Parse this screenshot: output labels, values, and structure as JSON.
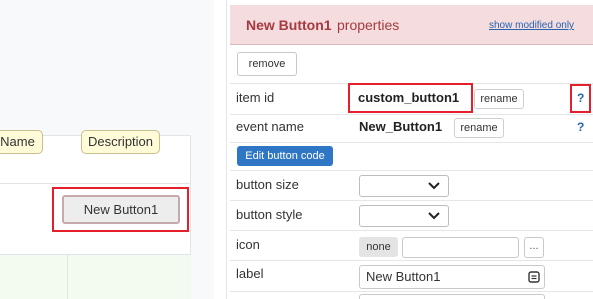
{
  "canvas": {
    "preview_button_label": "New Button1",
    "grid_headers": [
      "Name",
      "Description"
    ]
  },
  "panel": {
    "title": "New Button1",
    "title_suffix": "properties",
    "show_modified_label": "show modified only",
    "remove_label": "remove",
    "edit_code_label": "Edit button code",
    "help_glyph": "?",
    "rows": {
      "item_id": {
        "label": "item id",
        "value": "custom_button1",
        "rename_label": "rename"
      },
      "event_name": {
        "label": "event name",
        "value": "New_Button1",
        "rename_label": "rename"
      },
      "button_size": {
        "label": "button size",
        "value": ""
      },
      "button_style": {
        "label": "button style",
        "value": ""
      },
      "icon": {
        "label": "icon",
        "none_label": "none",
        "value": "",
        "browse_label": "..."
      },
      "label": {
        "label": "label",
        "value": "New Button1"
      }
    }
  },
  "colors": {
    "header_bg": "#f4dcdf",
    "title_color": "#a63a3e",
    "highlight_red": "#e5202a",
    "link_blue": "#2563b0",
    "primary_button": "#2f77c4",
    "chip_bg": "#fffbd9",
    "grid_row_bg": "#f3fbf1"
  },
  "icons": [
    "chevron-down-icon",
    "edit-text-icon",
    "help-icon"
  ]
}
